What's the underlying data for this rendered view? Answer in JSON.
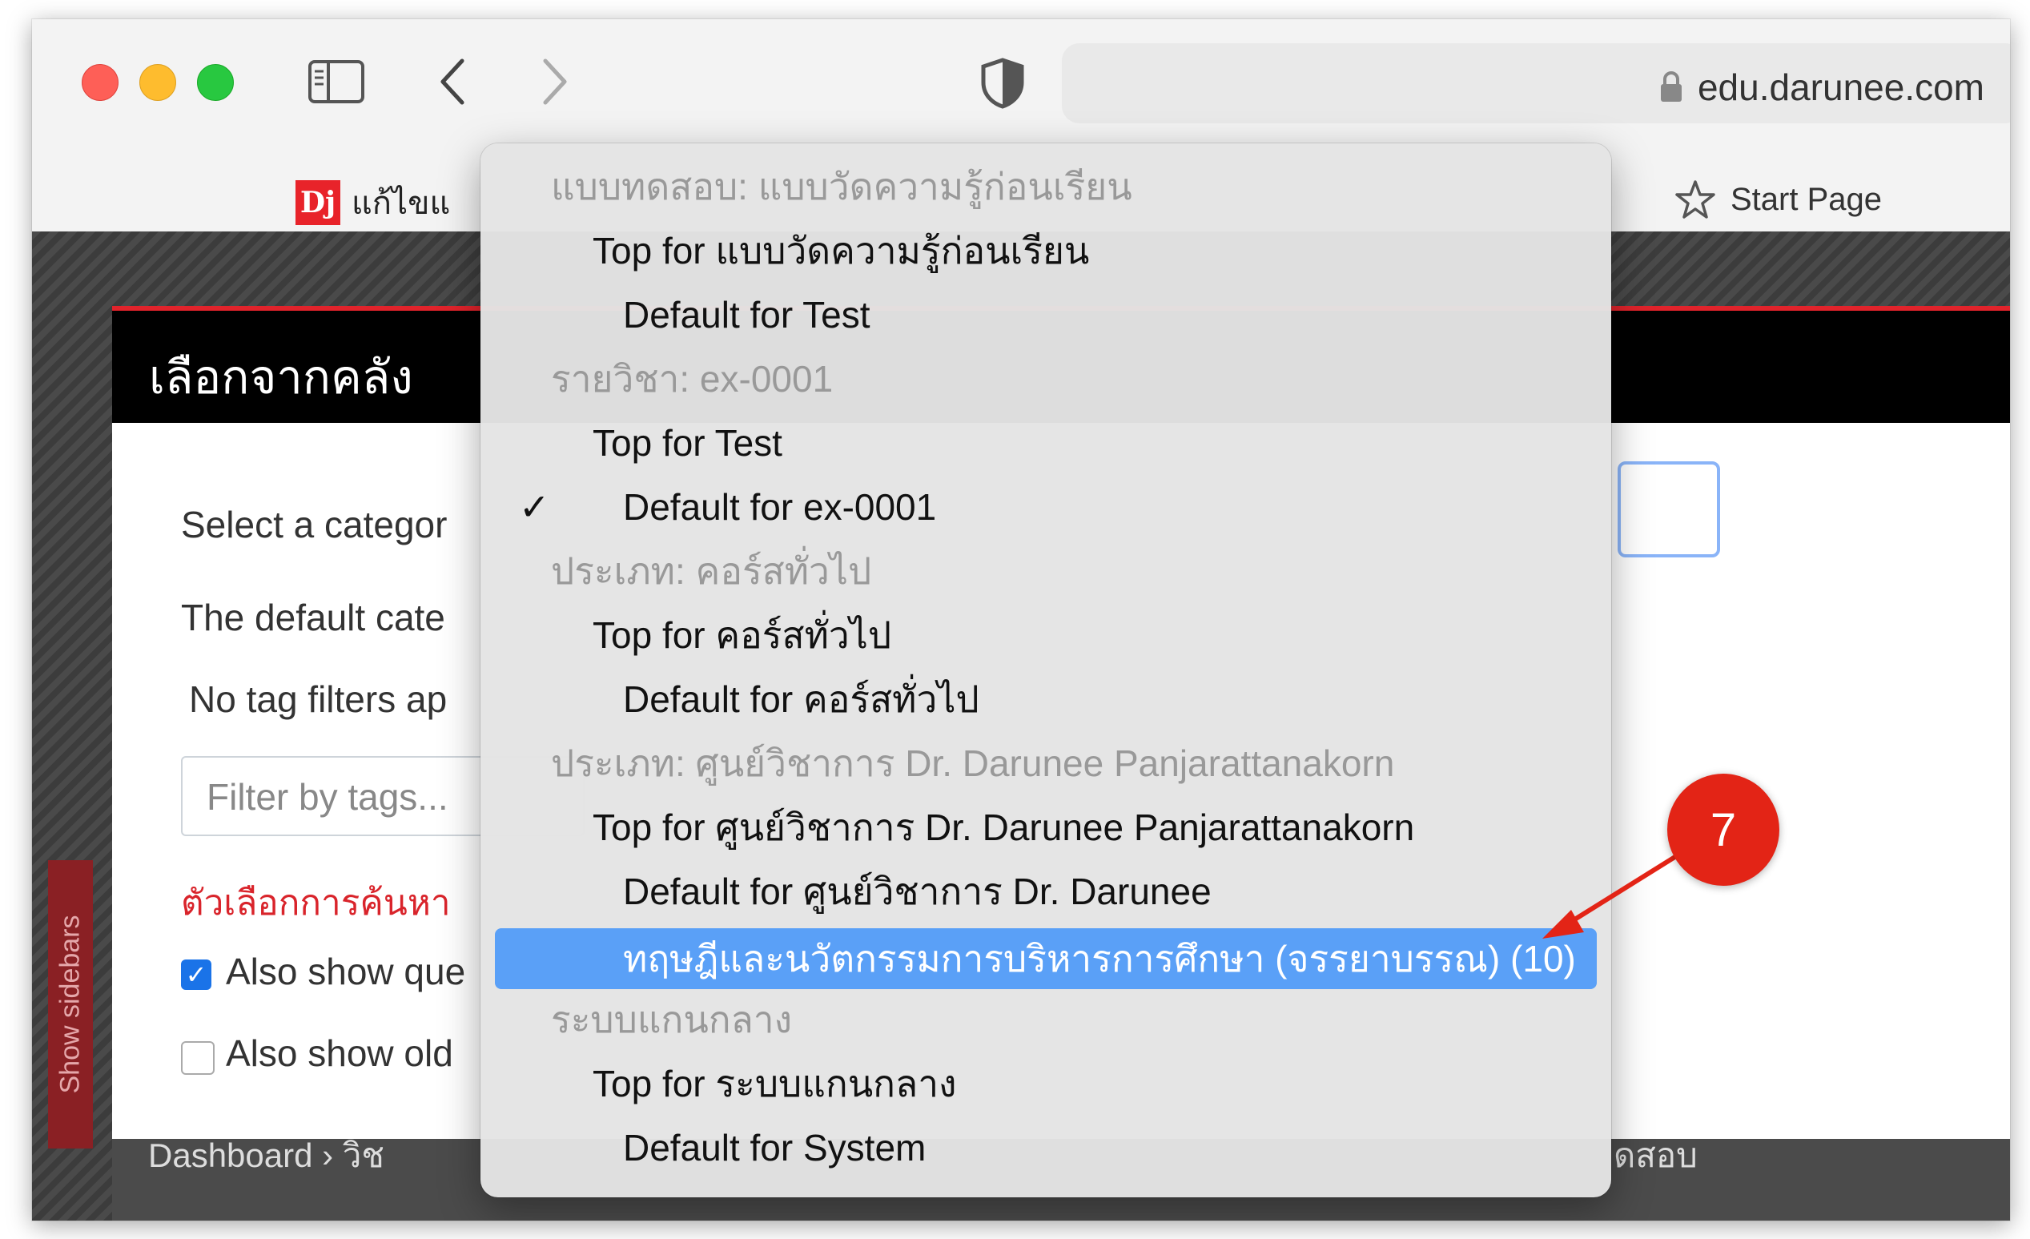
{
  "browser": {
    "url": "edu.darunee.com",
    "bookmarks": [
      {
        "label": "แก้ไขแ",
        "icon": "dj-logo"
      },
      {
        "label": "Start Page",
        "icon": "star-icon"
      }
    ],
    "dj_logo_text": "Dj"
  },
  "modal": {
    "title": "เลือกจากคลัง",
    "select_category_label": "Select a categor",
    "default_category_label": "The default cate",
    "no_tag_filters": "No tag filters ap",
    "filter_placeholder": "Filter by tags...",
    "search_options": "ตัวเลือกการค้นหา",
    "also_show_questions": "Also show que",
    "also_show_old": "Also show old",
    "side_tab": "Show sidebars"
  },
  "footer": {
    "breadcrumb": "Dashboard  ›  วิช",
    "breadcrumb_right": "ดสอบ"
  },
  "dropdown": {
    "items": [
      {
        "text": "แบบทดสอบ: แบบวัดความรู้ก่อนเรียน",
        "kind": "group"
      },
      {
        "text": "Top for แบบวัดความรู้ก่อนเรียน",
        "kind": "top"
      },
      {
        "text": "Default for Test",
        "kind": "default"
      },
      {
        "text": "รายวิชา: ex-0001",
        "kind": "group"
      },
      {
        "text": "Top for Test",
        "kind": "top"
      },
      {
        "text": "Default for ex-0001",
        "kind": "default",
        "checked": true
      },
      {
        "text": "ประเภท: คอร์สทั่วไป",
        "kind": "group"
      },
      {
        "text": "Top for คอร์สทั่วไป",
        "kind": "top"
      },
      {
        "text": "Default for คอร์สทั่วไป",
        "kind": "default"
      },
      {
        "text": "ประเภท: ศูนย์วิชาการ Dr. Darunee Panjarattanakorn",
        "kind": "group"
      },
      {
        "text": "Top for ศูนย์วิชาการ Dr. Darunee Panjarattanakorn",
        "kind": "top"
      },
      {
        "text": "Default for ศูนย์วิชาการ Dr. Darunee",
        "kind": "default"
      },
      {
        "text": "ทฤษฎีและนวัตกรรมการบริหารการศึกษา (จรรยาบรรณ) (10)",
        "kind": "default",
        "highlighted": true
      },
      {
        "text": "ระบบแกนกลาง",
        "kind": "group"
      },
      {
        "text": "Top for ระบบแกนกลาง",
        "kind": "top"
      },
      {
        "text": "Default for System",
        "kind": "default"
      }
    ],
    "check_glyph": "✓"
  },
  "annotation": {
    "badge_number": "7",
    "color": "#e32416"
  },
  "colors": {
    "highlight": "#5aa0f7",
    "modal_accent": "#e1232b",
    "search_options": "#d9242b"
  }
}
